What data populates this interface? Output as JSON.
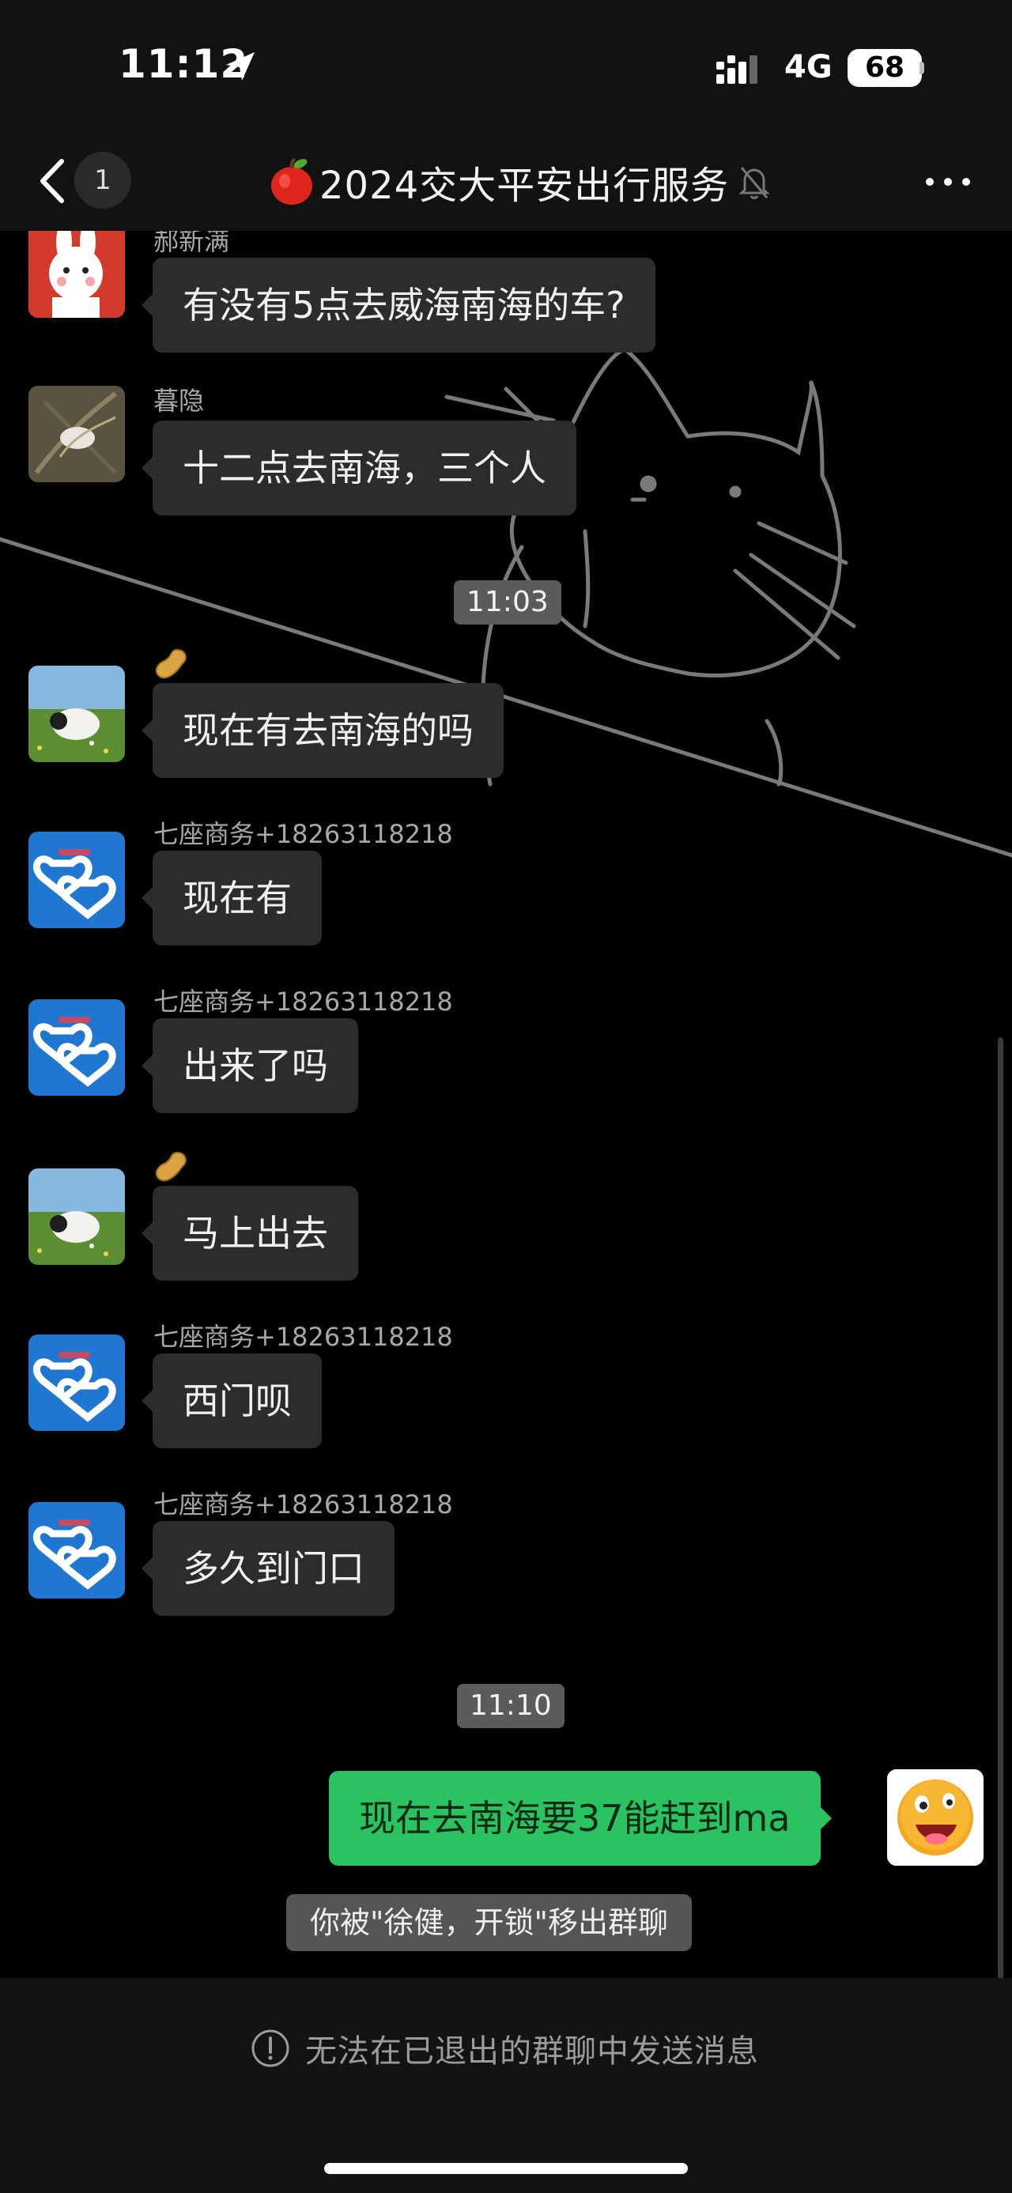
{
  "status_bar": {
    "time": "11:12",
    "network": "4G",
    "battery": "68"
  },
  "nav": {
    "back_count": "1",
    "title": "2024交大平安出行服务",
    "title_icon": "apple-icon",
    "muted": true
  },
  "timestamps": [
    "11:03",
    "11:10"
  ],
  "messages": [
    {
      "sender": "郝新满",
      "text": "有没有5点去威海南海的车?"
    },
    {
      "sender": "暮隐",
      "text": "十二点去南海，三个人"
    },
    {
      "sender_icon": "peanut-icon",
      "text": "现在有去南海的吗"
    },
    {
      "sender": "七座商务+18263118218",
      "text": "现在有"
    },
    {
      "sender": "七座商务+18263118218",
      "text": "出来了吗"
    },
    {
      "sender_icon": "peanut-icon",
      "text": "马上出去"
    },
    {
      "sender": "七座商务+18263118218",
      "text": "西门呗"
    },
    {
      "sender": "七座商务+18263118218",
      "text": "多久到门口"
    }
  ],
  "my_message": {
    "text": "现在去南海要37能赶到ma"
  },
  "system_notice": "你被\"徐健，开锁\"移出群聊",
  "bottom_notice": "无法在已退出的群聊中发送消息",
  "colors": {
    "my_bubble": "#2bc362",
    "other_bubble": "#2c2c2c",
    "background": "#000000"
  }
}
